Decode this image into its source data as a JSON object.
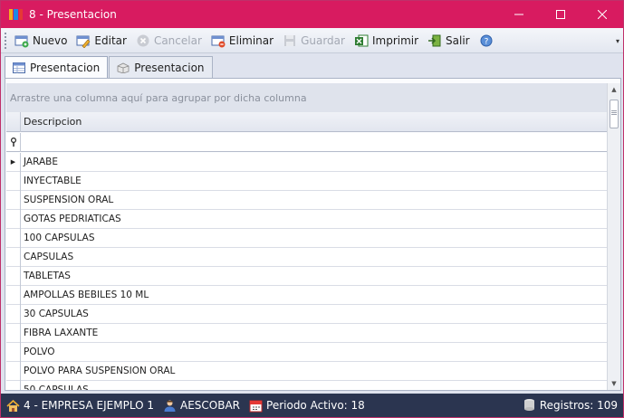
{
  "window": {
    "title": "8 - Presentacion",
    "minimize": "—",
    "maximize": "☐",
    "close": "✕"
  },
  "toolbar": {
    "nuevo": "Nuevo",
    "editar": "Editar",
    "cancelar": "Cancelar",
    "eliminar": "Eliminar",
    "guardar": "Guardar",
    "imprimir": "Imprimir",
    "salir": "Salir",
    "more": "▾"
  },
  "tabs": [
    {
      "label": "Presentacion",
      "active": true
    },
    {
      "label": "Presentacion",
      "active": false
    }
  ],
  "grid": {
    "group_hint": "Arrastre una columna aquí para agrupar por dicha columna",
    "column": "Descripcion",
    "filter_icon": "⚲",
    "current_row_marker": "▶",
    "rows": [
      "JARABE",
      "INYECTABLE",
      "SUSPENSION ORAL",
      "GOTAS PEDRIATICAS",
      "100 CAPSULAS",
      "CAPSULAS",
      "TABLETAS",
      "AMPOLLAS BEBILES 10 ML",
      "30 CAPSULAS",
      "FIBRA LAXANTE",
      "POLVO",
      "POLVO PARA SUSPENSION ORAL",
      "50 CAPSULAS"
    ]
  },
  "status": {
    "empresa": "4 - EMPRESA EJEMPLO 1",
    "usuario": "AESCOBAR",
    "periodo": "Periodo Activo: 18",
    "registros": "Registros: 109"
  },
  "colors": {
    "titlebar": "#d81b60",
    "statusbar": "#2b3550"
  }
}
